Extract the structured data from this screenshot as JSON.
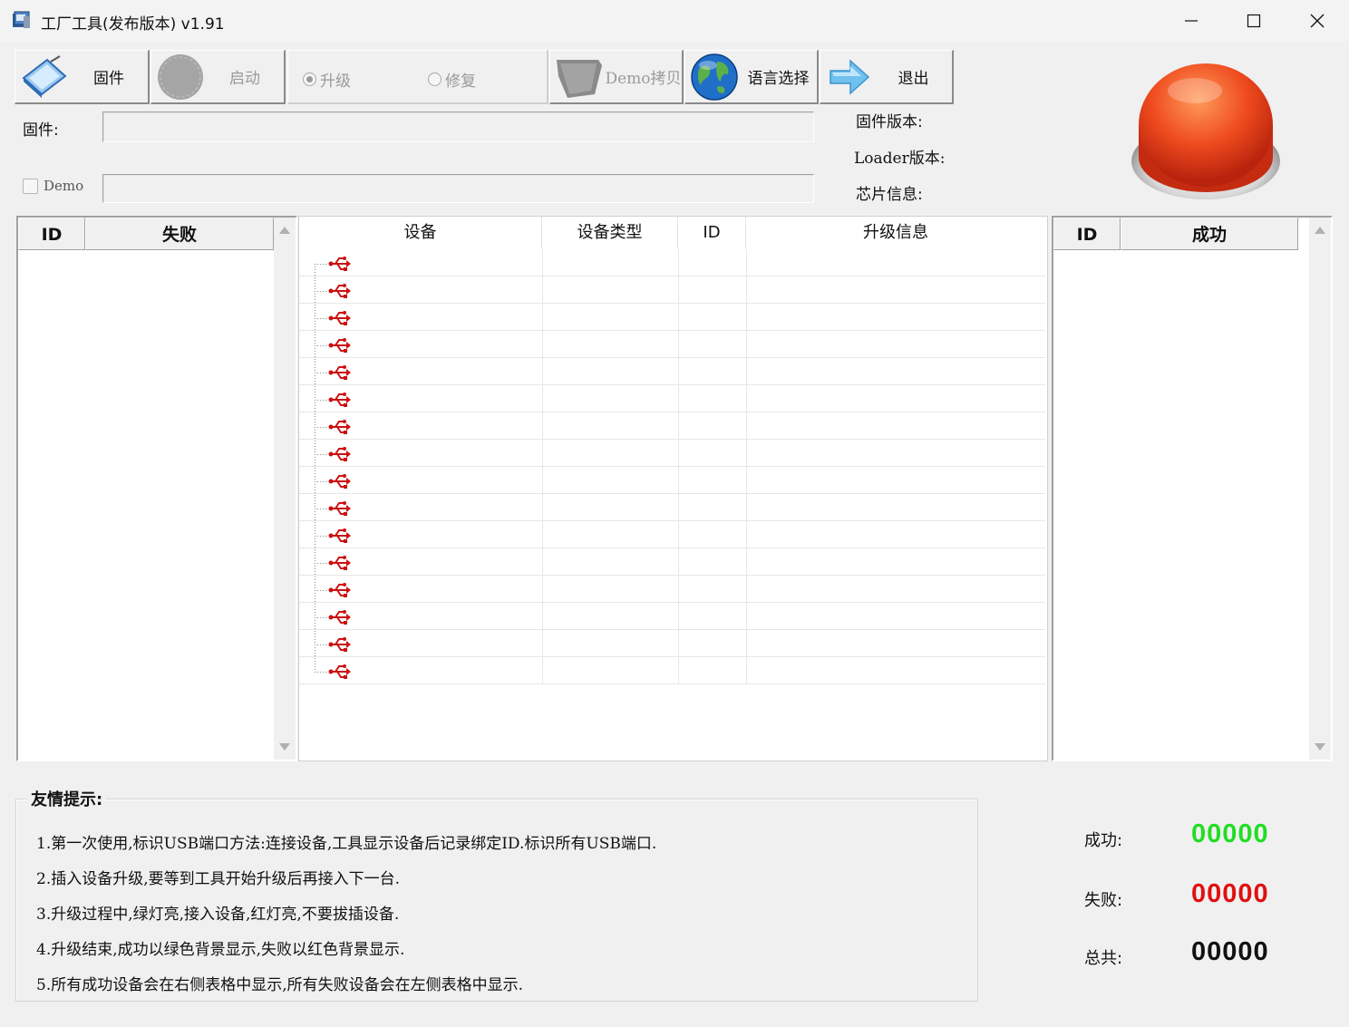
{
  "window": {
    "title": "工厂工具(发布版本) v1.91"
  },
  "toolbar": {
    "firmware_label": "固件",
    "start_label": "启动",
    "upgrade_label": "升级",
    "repair_label": "修复",
    "demo_copy_label": "Demo拷贝",
    "language_label": "语言选择",
    "exit_label": "退出"
  },
  "form": {
    "firmware_label": "固件:",
    "firmware_value": "",
    "demo_label": "Demo",
    "demo_value": "",
    "firmware_version_label": "固件版本:",
    "loader_version_label": "Loader版本:",
    "chip_info_label": "芯片信息:"
  },
  "fail_table": {
    "col_id": "ID",
    "col_status": "失败"
  },
  "success_table": {
    "col_id": "ID",
    "col_status": "成功"
  },
  "device_table": {
    "headers": [
      "设备",
      "设备类型",
      "ID",
      "升级信息"
    ],
    "row_count": 16
  },
  "tips": {
    "title": "友情提示:",
    "lines": [
      "1.第一次使用,标识USB端口方法:连接设备,工具显示设备后记录绑定ID.标识所有USB端口.",
      "2.插入设备升级,要等到工具开始升级后再接入下一台.",
      "3.升级过程中,绿灯亮,接入设备,红灯亮,不要拔插设备.",
      "4.升级结束,成功以绿色背景显示,失败以红色背景显示.",
      "5.所有成功设备会在右侧表格中显示,所有失败设备会在左侧表格中显示."
    ]
  },
  "counters": {
    "success_label": "成功:",
    "success_value": "00000",
    "fail_label": "失败:",
    "fail_value": "00000",
    "total_label": "总共:",
    "total_value": "00000"
  },
  "colors": {
    "success": "#22dd22",
    "fail": "#e01010",
    "total": "#111111",
    "status_light": "#e8401c",
    "usb_icon": "#cc1111"
  },
  "icons": {
    "app": "app-window-icon",
    "firmware": "firmware-card-icon",
    "start": "start-disc-icon",
    "demo_copy": "demo-folder-icon",
    "language": "globe-icon",
    "exit": "arrow-right-icon",
    "status_light": "red-status-button-icon",
    "device_row": "usb-icon"
  }
}
